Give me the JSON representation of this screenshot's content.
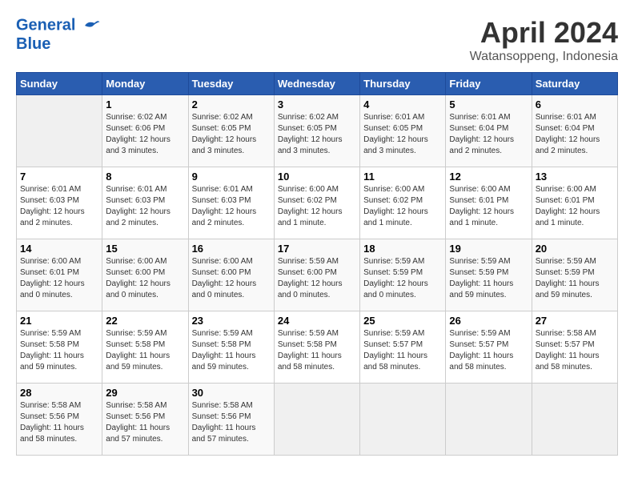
{
  "header": {
    "logo_line1": "General",
    "logo_line2": "Blue",
    "month_year": "April 2024",
    "location": "Watansoppeng, Indonesia"
  },
  "weekdays": [
    "Sunday",
    "Monday",
    "Tuesday",
    "Wednesday",
    "Thursday",
    "Friday",
    "Saturday"
  ],
  "weeks": [
    [
      {
        "day": "",
        "sunrise": "",
        "sunset": "",
        "daylight": ""
      },
      {
        "day": "1",
        "sunrise": "Sunrise: 6:02 AM",
        "sunset": "Sunset: 6:06 PM",
        "daylight": "Daylight: 12 hours and 3 minutes."
      },
      {
        "day": "2",
        "sunrise": "Sunrise: 6:02 AM",
        "sunset": "Sunset: 6:05 PM",
        "daylight": "Daylight: 12 hours and 3 minutes."
      },
      {
        "day": "3",
        "sunrise": "Sunrise: 6:02 AM",
        "sunset": "Sunset: 6:05 PM",
        "daylight": "Daylight: 12 hours and 3 minutes."
      },
      {
        "day": "4",
        "sunrise": "Sunrise: 6:01 AM",
        "sunset": "Sunset: 6:05 PM",
        "daylight": "Daylight: 12 hours and 3 minutes."
      },
      {
        "day": "5",
        "sunrise": "Sunrise: 6:01 AM",
        "sunset": "Sunset: 6:04 PM",
        "daylight": "Daylight: 12 hours and 2 minutes."
      },
      {
        "day": "6",
        "sunrise": "Sunrise: 6:01 AM",
        "sunset": "Sunset: 6:04 PM",
        "daylight": "Daylight: 12 hours and 2 minutes."
      }
    ],
    [
      {
        "day": "7",
        "sunrise": "Sunrise: 6:01 AM",
        "sunset": "Sunset: 6:03 PM",
        "daylight": "Daylight: 12 hours and 2 minutes."
      },
      {
        "day": "8",
        "sunrise": "Sunrise: 6:01 AM",
        "sunset": "Sunset: 6:03 PM",
        "daylight": "Daylight: 12 hours and 2 minutes."
      },
      {
        "day": "9",
        "sunrise": "Sunrise: 6:01 AM",
        "sunset": "Sunset: 6:03 PM",
        "daylight": "Daylight: 12 hours and 2 minutes."
      },
      {
        "day": "10",
        "sunrise": "Sunrise: 6:00 AM",
        "sunset": "Sunset: 6:02 PM",
        "daylight": "Daylight: 12 hours and 1 minute."
      },
      {
        "day": "11",
        "sunrise": "Sunrise: 6:00 AM",
        "sunset": "Sunset: 6:02 PM",
        "daylight": "Daylight: 12 hours and 1 minute."
      },
      {
        "day": "12",
        "sunrise": "Sunrise: 6:00 AM",
        "sunset": "Sunset: 6:01 PM",
        "daylight": "Daylight: 12 hours and 1 minute."
      },
      {
        "day": "13",
        "sunrise": "Sunrise: 6:00 AM",
        "sunset": "Sunset: 6:01 PM",
        "daylight": "Daylight: 12 hours and 1 minute."
      }
    ],
    [
      {
        "day": "14",
        "sunrise": "Sunrise: 6:00 AM",
        "sunset": "Sunset: 6:01 PM",
        "daylight": "Daylight: 12 hours and 0 minutes."
      },
      {
        "day": "15",
        "sunrise": "Sunrise: 6:00 AM",
        "sunset": "Sunset: 6:00 PM",
        "daylight": "Daylight: 12 hours and 0 minutes."
      },
      {
        "day": "16",
        "sunrise": "Sunrise: 6:00 AM",
        "sunset": "Sunset: 6:00 PM",
        "daylight": "Daylight: 12 hours and 0 minutes."
      },
      {
        "day": "17",
        "sunrise": "Sunrise: 5:59 AM",
        "sunset": "Sunset: 6:00 PM",
        "daylight": "Daylight: 12 hours and 0 minutes."
      },
      {
        "day": "18",
        "sunrise": "Sunrise: 5:59 AM",
        "sunset": "Sunset: 5:59 PM",
        "daylight": "Daylight: 12 hours and 0 minutes."
      },
      {
        "day": "19",
        "sunrise": "Sunrise: 5:59 AM",
        "sunset": "Sunset: 5:59 PM",
        "daylight": "Daylight: 11 hours and 59 minutes."
      },
      {
        "day": "20",
        "sunrise": "Sunrise: 5:59 AM",
        "sunset": "Sunset: 5:59 PM",
        "daylight": "Daylight: 11 hours and 59 minutes."
      }
    ],
    [
      {
        "day": "21",
        "sunrise": "Sunrise: 5:59 AM",
        "sunset": "Sunset: 5:58 PM",
        "daylight": "Daylight: 11 hours and 59 minutes."
      },
      {
        "day": "22",
        "sunrise": "Sunrise: 5:59 AM",
        "sunset": "Sunset: 5:58 PM",
        "daylight": "Daylight: 11 hours and 59 minutes."
      },
      {
        "day": "23",
        "sunrise": "Sunrise: 5:59 AM",
        "sunset": "Sunset: 5:58 PM",
        "daylight": "Daylight: 11 hours and 59 minutes."
      },
      {
        "day": "24",
        "sunrise": "Sunrise: 5:59 AM",
        "sunset": "Sunset: 5:58 PM",
        "daylight": "Daylight: 11 hours and 58 minutes."
      },
      {
        "day": "25",
        "sunrise": "Sunrise: 5:59 AM",
        "sunset": "Sunset: 5:57 PM",
        "daylight": "Daylight: 11 hours and 58 minutes."
      },
      {
        "day": "26",
        "sunrise": "Sunrise: 5:59 AM",
        "sunset": "Sunset: 5:57 PM",
        "daylight": "Daylight: 11 hours and 58 minutes."
      },
      {
        "day": "27",
        "sunrise": "Sunrise: 5:58 AM",
        "sunset": "Sunset: 5:57 PM",
        "daylight": "Daylight: 11 hours and 58 minutes."
      }
    ],
    [
      {
        "day": "28",
        "sunrise": "Sunrise: 5:58 AM",
        "sunset": "Sunset: 5:56 PM",
        "daylight": "Daylight: 11 hours and 58 minutes."
      },
      {
        "day": "29",
        "sunrise": "Sunrise: 5:58 AM",
        "sunset": "Sunset: 5:56 PM",
        "daylight": "Daylight: 11 hours and 57 minutes."
      },
      {
        "day": "30",
        "sunrise": "Sunrise: 5:58 AM",
        "sunset": "Sunset: 5:56 PM",
        "daylight": "Daylight: 11 hours and 57 minutes."
      },
      {
        "day": "",
        "sunrise": "",
        "sunset": "",
        "daylight": ""
      },
      {
        "day": "",
        "sunrise": "",
        "sunset": "",
        "daylight": ""
      },
      {
        "day": "",
        "sunrise": "",
        "sunset": "",
        "daylight": ""
      },
      {
        "day": "",
        "sunrise": "",
        "sunset": "",
        "daylight": ""
      }
    ]
  ]
}
